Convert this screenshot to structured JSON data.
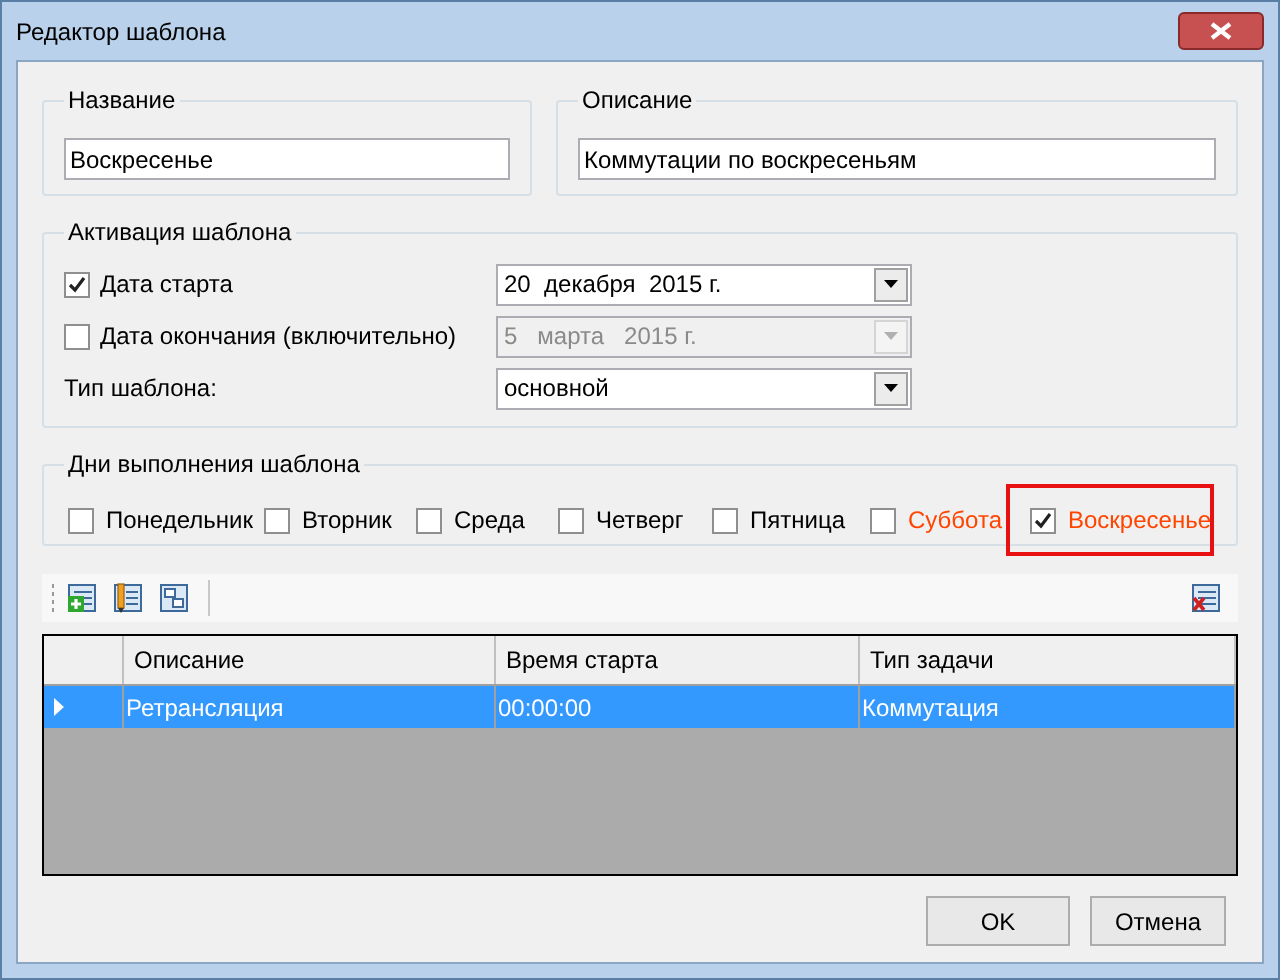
{
  "window": {
    "title": "Редактор шаблона"
  },
  "name_group": {
    "title": "Название",
    "value": "Воскресенье"
  },
  "description_group": {
    "title": "Описание",
    "value": "Коммутации по воскресеньям"
  },
  "activation": {
    "title": "Активация шаблона",
    "rows": [
      {
        "kind": "checkbox",
        "label": "Дата старта",
        "checked": true,
        "value": "20  декабря  2015 г.",
        "disabled": false
      },
      {
        "kind": "checkbox",
        "label": "Дата окончания (включительно)",
        "checked": false,
        "value": "5   марта   2015 г.",
        "disabled": true
      },
      {
        "kind": "label",
        "label": "Тип шаблона:",
        "value": "основной",
        "disabled": false
      }
    ]
  },
  "days": {
    "title": "Дни выполнения шаблона",
    "items": [
      {
        "label": "Понедельник",
        "checked": false,
        "color": "#000000",
        "highlighted": false
      },
      {
        "label": "Вторник",
        "checked": false,
        "color": "#000000",
        "highlighted": false
      },
      {
        "label": "Среда",
        "checked": false,
        "color": "#000000",
        "highlighted": false
      },
      {
        "label": "Четверг",
        "checked": false,
        "color": "#000000",
        "highlighted": false
      },
      {
        "label": "Пятница",
        "checked": false,
        "color": "#000000",
        "highlighted": false
      },
      {
        "label": "Суббота",
        "checked": false,
        "color": "#ff4500",
        "highlighted": false
      },
      {
        "label": "Воскресенье",
        "checked": true,
        "color": "#ff4500",
        "highlighted": true
      }
    ]
  },
  "table": {
    "columns": [
      "Описание",
      "Время старта",
      "Тип задачи"
    ],
    "rows": [
      {
        "cells": [
          "Ретрансляция",
          "00:00:00",
          "Коммутация"
        ],
        "selected": true
      }
    ]
  },
  "buttons": [
    "OK",
    "Отмена"
  ]
}
